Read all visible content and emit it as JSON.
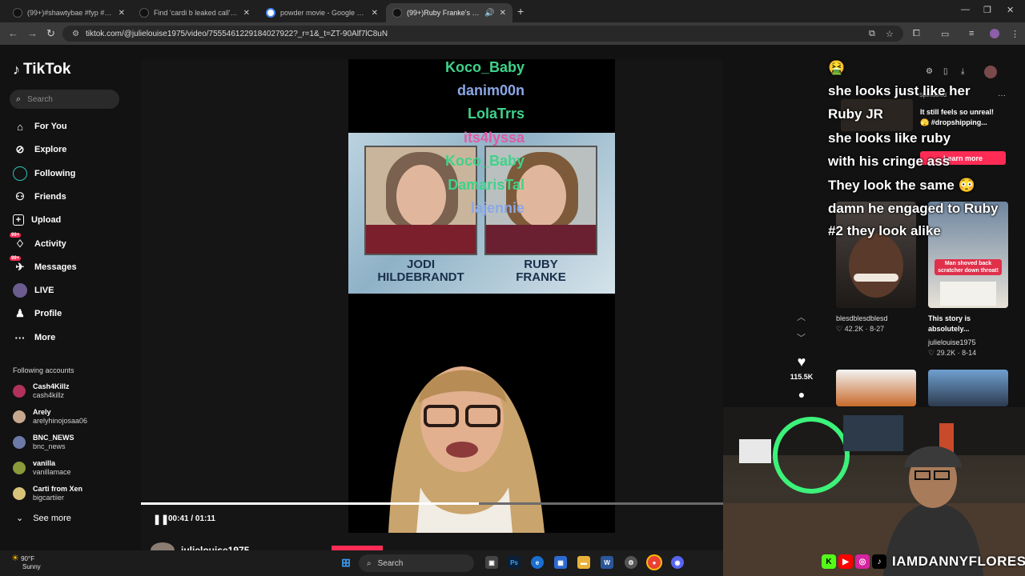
{
  "browser": {
    "tabs": [
      {
        "title": "(99+)#shawtybae #fyp #shawty",
        "favicon_color": "#111111"
      },
      {
        "title": "Find 'cardi b leaked call' on TikTok",
        "favicon_color": "#111111"
      },
      {
        "title": "powder movie - Google Search",
        "favicon_color": "#4285f4"
      },
      {
        "title": "(99+)Ruby Franke's ex-husband",
        "favicon_color": "#111111"
      }
    ],
    "address": "tiktok.com/@julielouise1975/video/7555461229184027922?_r=1&_t=ZT-90Alf7lC8uN"
  },
  "sidebar": {
    "logo": "TikTok",
    "search_placeholder": "Search",
    "nav": [
      {
        "label": "For You",
        "icon": "home-icon"
      },
      {
        "label": "Explore",
        "icon": "compass-icon"
      },
      {
        "label": "Following",
        "icon": "following-icon"
      },
      {
        "label": "Friends",
        "icon": "friends-icon"
      },
      {
        "label": "Upload",
        "icon": "upload-icon"
      },
      {
        "label": "Activity",
        "icon": "activity-icon",
        "badge": "99+"
      },
      {
        "label": "Messages",
        "icon": "messages-icon",
        "badge": "99+"
      },
      {
        "label": "LIVE",
        "icon": "live-icon"
      },
      {
        "label": "Profile",
        "icon": "profile-icon"
      },
      {
        "label": "More",
        "icon": "more-icon"
      }
    ],
    "following_heading": "Following accounts",
    "accounts": [
      {
        "name": "Cash4Killz",
        "handle": "cash4killz",
        "color": "#b0325a"
      },
      {
        "name": "Arely",
        "handle": "arelyhinojosaa06",
        "color": "#c7a88e"
      },
      {
        "name": "BNC_NEWS",
        "handle": "bnc_news",
        "color": "#6d7aa8"
      },
      {
        "name": "vanilla",
        "handle": "vanillamace",
        "color": "#8a9a3a"
      },
      {
        "name": "Carti from Xen",
        "handle": "bigcartiier",
        "color": "#d9c27a"
      }
    ],
    "see_more": "See more"
  },
  "video": {
    "mugshot_left": "JODI\nHILDEBRANDT",
    "mugshot_left_l1": "JODI",
    "mugshot_left_l2": "HILDEBRANDT",
    "mugshot_right_l1": "RUBY",
    "mugshot_right_l2": "FRANKE",
    "time": "00:41 / 01:11",
    "progress": 0.58,
    "author": "julielouise1975"
  },
  "actions": {
    "likes": "115.5K"
  },
  "right_panel": {
    "sponsored": "Sponsored",
    "ad_text_1": "It still feels so unreal!",
    "ad_text_2": "🫣 #dropshipping...",
    "learn_more": "Learn more",
    "thumbs": [
      {
        "caption": "",
        "user": "blesdblesdblesd",
        "likes": "42.2K",
        "date": "8-27"
      },
      {
        "caption": "This story is absolutely...",
        "user": "julielouise1975",
        "likes": "29.2K",
        "date": "8-14"
      }
    ],
    "thumb_overlay": "Man shoved back scratcher down throat!"
  },
  "chat": [
    {
      "name": "Koco_Baby",
      "message": "🤮",
      "color": "#3fd28a"
    },
    {
      "name": "danim00n",
      "message": "she looks just like her",
      "color": "#8aa7e8"
    },
    {
      "name": "LolaTrrs",
      "message": "Ruby JR",
      "color": "#3fd28a"
    },
    {
      "name": "its4lyssa",
      "message": "she looks like ruby",
      "color": "#e05aa5"
    },
    {
      "name": "Koco_Baby",
      "message": "with his cringe ass",
      "color": "#3fd28a"
    },
    {
      "name": "DamarisTal",
      "message": "They look the same 😳",
      "color": "#3fd28a"
    },
    {
      "name": "lajennie",
      "message": "damn he engaged to Ruby",
      "color": "#8aa7e8"
    },
    {
      "name": "",
      "message": "#2 they look alike",
      "color": "#ffffff"
    }
  ],
  "webcam": {
    "handle": "IAMDANNYFLORES"
  },
  "taskbar": {
    "temp": "90°F",
    "condition": "Sunny",
    "search": "Search"
  }
}
